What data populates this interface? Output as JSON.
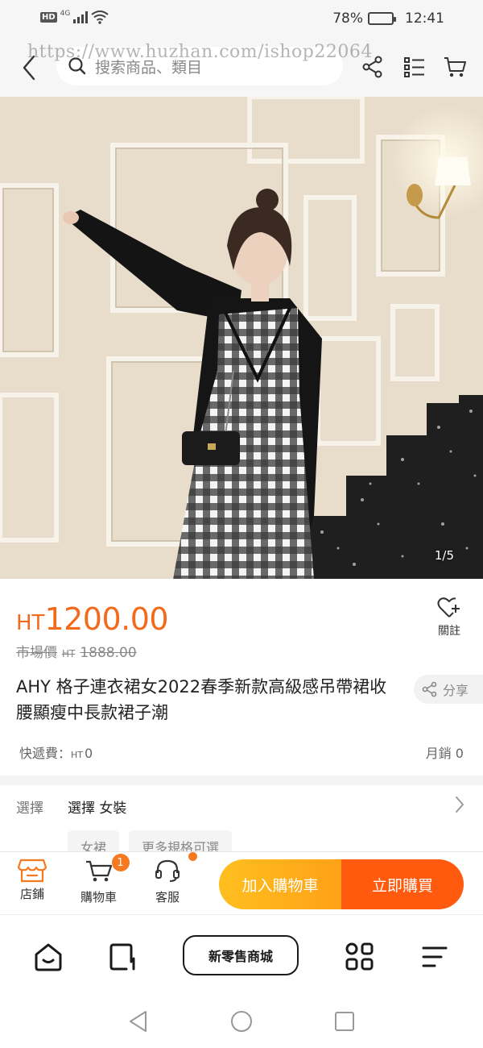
{
  "status_bar": {
    "hd": "HD",
    "network": "4G",
    "battery": "78%",
    "battery_level": 0.78,
    "time": "12:41"
  },
  "top_nav": {
    "search_placeholder": "搜索商品、類目",
    "watermark": "https://www.huzhan.com/ishop22064"
  },
  "product_image": {
    "counter": "1/5"
  },
  "product": {
    "currency": "HT",
    "price": "1200.00",
    "market_label": "市場價",
    "market_currency": "HT",
    "market_price": "1888.00",
    "follow_label": "關註",
    "title": "AHY 格子連衣裙女2022春季新款高級感吊帶裙收腰顯瘦中長款裙子潮",
    "share_label": "分享",
    "shipping_label": "快遞費：",
    "shipping_currency": "HT",
    "shipping_value": "0",
    "monthly_sales": "月銷 0"
  },
  "selection": {
    "label": "選擇",
    "value": "選擇 女裝",
    "chips": [
      "女裙",
      "更多規格可選"
    ]
  },
  "action_bar": {
    "store_label": "店鋪",
    "cart_label": "購物車",
    "cart_count": "1",
    "service_label": "客服",
    "add_to_cart": "加入購物車",
    "buy_now": "立即購買"
  },
  "tab_bar": {
    "mall_label": "新零售商城"
  },
  "colors": {
    "accent": "#f26a1b",
    "add_cart": "#ffb11c",
    "buy_now": "#ff5a0e"
  },
  "icons": [
    "back-icon",
    "search-icon",
    "share-icon",
    "list-icon",
    "cart-icon",
    "heart-plus-icon",
    "store-icon",
    "headset-icon",
    "home-icon",
    "page-icon",
    "grid-icon",
    "menu-icon",
    "triangle-back-icon",
    "circle-home-icon",
    "square-recents-icon"
  ]
}
